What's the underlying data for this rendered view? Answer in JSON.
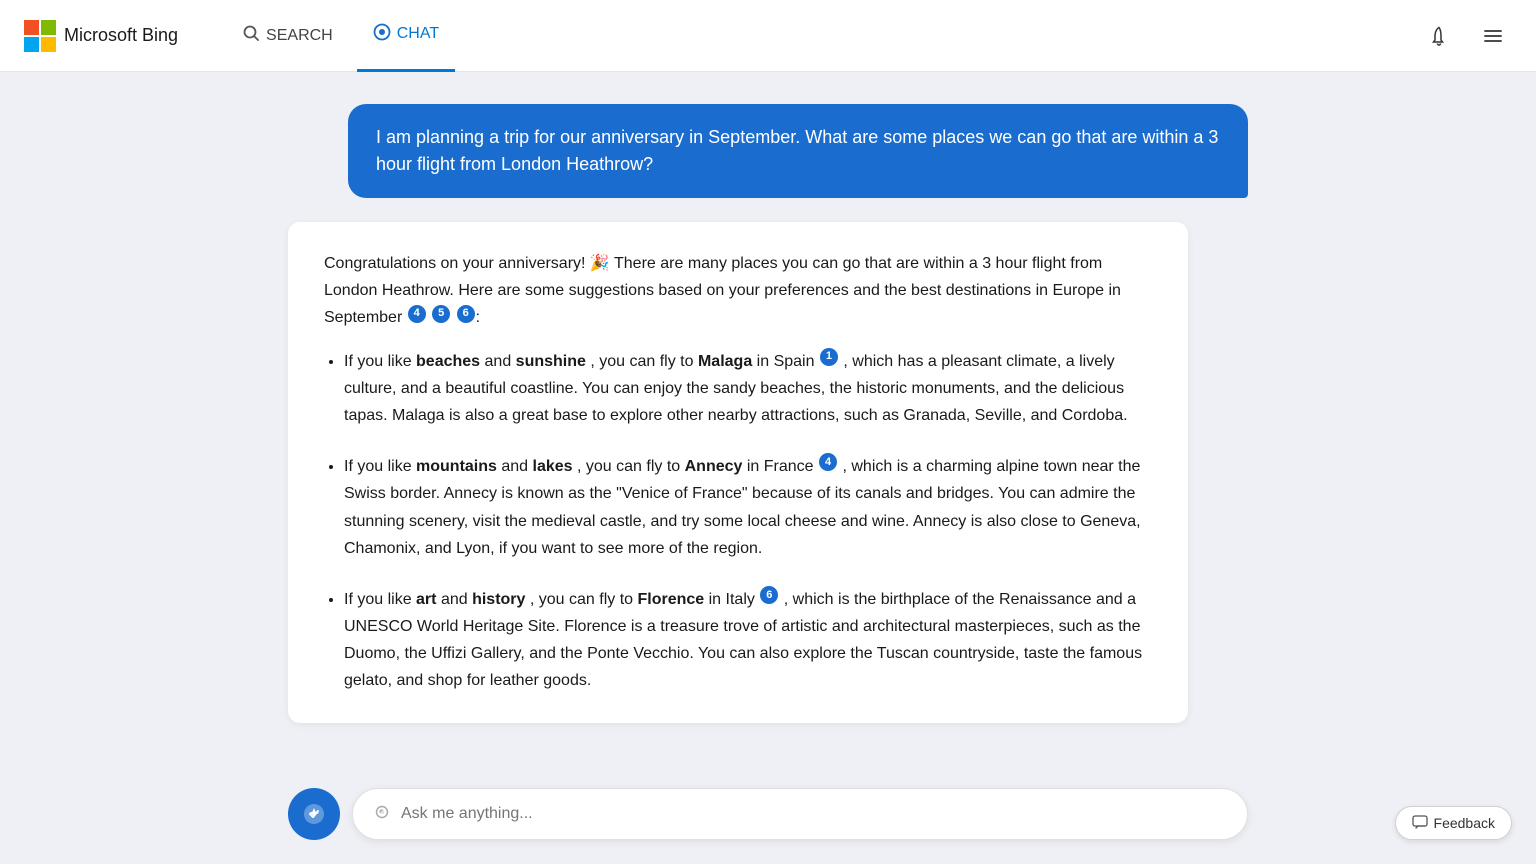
{
  "header": {
    "logo_text": "Microsoft Bing",
    "nav": [
      {
        "id": "search",
        "label": "SEARCH",
        "active": false,
        "icon": "🔍"
      },
      {
        "id": "chat",
        "label": "CHAT",
        "active": true,
        "icon": "💬"
      }
    ]
  },
  "user_message": {
    "text": "I am planning a trip for our anniversary in September. What are some places we can go that are within a 3 hour flight from London Heathrow?"
  },
  "ai_response": {
    "intro": "Congratulations on your anniversary! 🎉 There are many places you can go that are within a 3 hour flight from London Heathrow. Here are some suggestions based on your preferences and the best destinations in Europe in September",
    "intro_refs": [
      "4",
      "5",
      "6"
    ],
    "items": [
      {
        "prefix": "If you like ",
        "bold1": "beaches",
        "mid1": " and ",
        "bold2": "sunshine",
        "mid2": ", you can fly to ",
        "destination": "Malaga",
        "dest_suffix": " in Spain",
        "refs": [
          "1"
        ],
        "body": ", which has a pleasant climate, a lively culture, and a beautiful coastline. You can enjoy the sandy beaches, the historic monuments, and the delicious tapas. Malaga is also a great base to explore other nearby attractions, such as Granada, Seville, and Cordoba."
      },
      {
        "prefix": "If you like ",
        "bold1": "mountains",
        "mid1": " and ",
        "bold2": "lakes",
        "mid2": ", you can fly to ",
        "destination": "Annecy",
        "dest_suffix": " in France",
        "refs": [
          "4"
        ],
        "body": ", which is a charming alpine town near the Swiss border. Annecy is known as the \"Venice of France\" because of its canals and bridges. You can admire the stunning scenery, visit the medieval castle, and try some local cheese and wine. Annecy is also close to Geneva, Chamonix, and Lyon, if you want to see more of the region."
      },
      {
        "prefix": "If you like ",
        "bold1": "art",
        "mid1": " and ",
        "bold2": "history",
        "mid2": ", you can fly to ",
        "destination": "Florence",
        "dest_suffix": " in Italy",
        "refs": [
          "6"
        ],
        "body": ", which is the birthplace of the Renaissance and a UNESCO World Heritage Site. Florence is a treasure trove of artistic and architectural masterpieces, such as the Duomo, the Uffizi Gallery, and the Ponte Vecchio. You can also explore the Tuscan countryside, taste the famous gelato, and shop for leather goods."
      }
    ]
  },
  "input": {
    "placeholder": "Ask me anything..."
  },
  "feedback": {
    "label": "Feedback"
  }
}
